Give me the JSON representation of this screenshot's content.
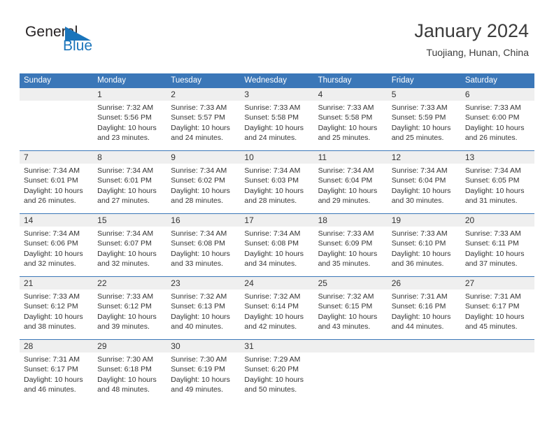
{
  "brand": {
    "name_part1": "General",
    "name_part2": "Blue",
    "accent_color": "#1b75bb"
  },
  "header": {
    "title": "January 2024",
    "location": "Tuojiang, Hunan, China"
  },
  "theme": {
    "header_blue": "#3b77b8",
    "daynum_band": "#efefef",
    "text": "#333333"
  },
  "weekdays": [
    "Sunday",
    "Monday",
    "Tuesday",
    "Wednesday",
    "Thursday",
    "Friday",
    "Saturday"
  ],
  "weeks": [
    [
      {
        "day": "",
        "lines": []
      },
      {
        "day": "1",
        "lines": [
          "Sunrise: 7:32 AM",
          "Sunset: 5:56 PM",
          "Daylight: 10 hours",
          "and 23 minutes."
        ]
      },
      {
        "day": "2",
        "lines": [
          "Sunrise: 7:33 AM",
          "Sunset: 5:57 PM",
          "Daylight: 10 hours",
          "and 24 minutes."
        ]
      },
      {
        "day": "3",
        "lines": [
          "Sunrise: 7:33 AM",
          "Sunset: 5:58 PM",
          "Daylight: 10 hours",
          "and 24 minutes."
        ]
      },
      {
        "day": "4",
        "lines": [
          "Sunrise: 7:33 AM",
          "Sunset: 5:58 PM",
          "Daylight: 10 hours",
          "and 25 minutes."
        ]
      },
      {
        "day": "5",
        "lines": [
          "Sunrise: 7:33 AM",
          "Sunset: 5:59 PM",
          "Daylight: 10 hours",
          "and 25 minutes."
        ]
      },
      {
        "day": "6",
        "lines": [
          "Sunrise: 7:33 AM",
          "Sunset: 6:00 PM",
          "Daylight: 10 hours",
          "and 26 minutes."
        ]
      }
    ],
    [
      {
        "day": "7",
        "lines": [
          "Sunrise: 7:34 AM",
          "Sunset: 6:01 PM",
          "Daylight: 10 hours",
          "and 26 minutes."
        ]
      },
      {
        "day": "8",
        "lines": [
          "Sunrise: 7:34 AM",
          "Sunset: 6:01 PM",
          "Daylight: 10 hours",
          "and 27 minutes."
        ]
      },
      {
        "day": "9",
        "lines": [
          "Sunrise: 7:34 AM",
          "Sunset: 6:02 PM",
          "Daylight: 10 hours",
          "and 28 minutes."
        ]
      },
      {
        "day": "10",
        "lines": [
          "Sunrise: 7:34 AM",
          "Sunset: 6:03 PM",
          "Daylight: 10 hours",
          "and 28 minutes."
        ]
      },
      {
        "day": "11",
        "lines": [
          "Sunrise: 7:34 AM",
          "Sunset: 6:04 PM",
          "Daylight: 10 hours",
          "and 29 minutes."
        ]
      },
      {
        "day": "12",
        "lines": [
          "Sunrise: 7:34 AM",
          "Sunset: 6:04 PM",
          "Daylight: 10 hours",
          "and 30 minutes."
        ]
      },
      {
        "day": "13",
        "lines": [
          "Sunrise: 7:34 AM",
          "Sunset: 6:05 PM",
          "Daylight: 10 hours",
          "and 31 minutes."
        ]
      }
    ],
    [
      {
        "day": "14",
        "lines": [
          "Sunrise: 7:34 AM",
          "Sunset: 6:06 PM",
          "Daylight: 10 hours",
          "and 32 minutes."
        ]
      },
      {
        "day": "15",
        "lines": [
          "Sunrise: 7:34 AM",
          "Sunset: 6:07 PM",
          "Daylight: 10 hours",
          "and 32 minutes."
        ]
      },
      {
        "day": "16",
        "lines": [
          "Sunrise: 7:34 AM",
          "Sunset: 6:08 PM",
          "Daylight: 10 hours",
          "and 33 minutes."
        ]
      },
      {
        "day": "17",
        "lines": [
          "Sunrise: 7:34 AM",
          "Sunset: 6:08 PM",
          "Daylight: 10 hours",
          "and 34 minutes."
        ]
      },
      {
        "day": "18",
        "lines": [
          "Sunrise: 7:33 AM",
          "Sunset: 6:09 PM",
          "Daylight: 10 hours",
          "and 35 minutes."
        ]
      },
      {
        "day": "19",
        "lines": [
          "Sunrise: 7:33 AM",
          "Sunset: 6:10 PM",
          "Daylight: 10 hours",
          "and 36 minutes."
        ]
      },
      {
        "day": "20",
        "lines": [
          "Sunrise: 7:33 AM",
          "Sunset: 6:11 PM",
          "Daylight: 10 hours",
          "and 37 minutes."
        ]
      }
    ],
    [
      {
        "day": "21",
        "lines": [
          "Sunrise: 7:33 AM",
          "Sunset: 6:12 PM",
          "Daylight: 10 hours",
          "and 38 minutes."
        ]
      },
      {
        "day": "22",
        "lines": [
          "Sunrise: 7:33 AM",
          "Sunset: 6:12 PM",
          "Daylight: 10 hours",
          "and 39 minutes."
        ]
      },
      {
        "day": "23",
        "lines": [
          "Sunrise: 7:32 AM",
          "Sunset: 6:13 PM",
          "Daylight: 10 hours",
          "and 40 minutes."
        ]
      },
      {
        "day": "24",
        "lines": [
          "Sunrise: 7:32 AM",
          "Sunset: 6:14 PM",
          "Daylight: 10 hours",
          "and 42 minutes."
        ]
      },
      {
        "day": "25",
        "lines": [
          "Sunrise: 7:32 AM",
          "Sunset: 6:15 PM",
          "Daylight: 10 hours",
          "and 43 minutes."
        ]
      },
      {
        "day": "26",
        "lines": [
          "Sunrise: 7:31 AM",
          "Sunset: 6:16 PM",
          "Daylight: 10 hours",
          "and 44 minutes."
        ]
      },
      {
        "day": "27",
        "lines": [
          "Sunrise: 7:31 AM",
          "Sunset: 6:17 PM",
          "Daylight: 10 hours",
          "and 45 minutes."
        ]
      }
    ],
    [
      {
        "day": "28",
        "lines": [
          "Sunrise: 7:31 AM",
          "Sunset: 6:17 PM",
          "Daylight: 10 hours",
          "and 46 minutes."
        ]
      },
      {
        "day": "29",
        "lines": [
          "Sunrise: 7:30 AM",
          "Sunset: 6:18 PM",
          "Daylight: 10 hours",
          "and 48 minutes."
        ]
      },
      {
        "day": "30",
        "lines": [
          "Sunrise: 7:30 AM",
          "Sunset: 6:19 PM",
          "Daylight: 10 hours",
          "and 49 minutes."
        ]
      },
      {
        "day": "31",
        "lines": [
          "Sunrise: 7:29 AM",
          "Sunset: 6:20 PM",
          "Daylight: 10 hours",
          "and 50 minutes."
        ]
      },
      {
        "day": "",
        "lines": []
      },
      {
        "day": "",
        "lines": []
      },
      {
        "day": "",
        "lines": []
      }
    ]
  ]
}
